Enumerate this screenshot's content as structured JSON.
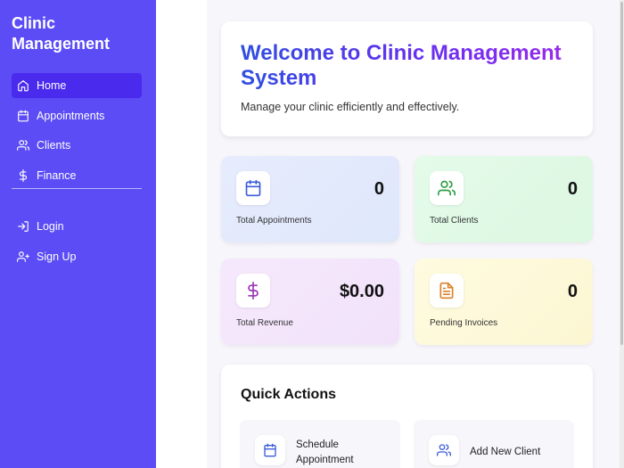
{
  "sidebar": {
    "brand": "Clinic Management",
    "items": [
      {
        "label": "Home",
        "icon": "home-icon",
        "active": true
      },
      {
        "label": "Appointments",
        "icon": "calendar-icon"
      },
      {
        "label": "Clients",
        "icon": "users-icon"
      },
      {
        "label": "Finance",
        "icon": "dollar-icon"
      }
    ],
    "auth_items": [
      {
        "label": "Login",
        "icon": "login-icon"
      },
      {
        "label": "Sign Up",
        "icon": "user-plus-icon"
      }
    ]
  },
  "welcome": {
    "title": "Welcome to Clinic Management System",
    "subtitle": "Manage your clinic efficiently and effectively."
  },
  "stats": [
    {
      "value": "0",
      "label": "Total Appointments",
      "icon": "calendar-icon",
      "color": "#3b5bdb"
    },
    {
      "value": "0",
      "label": "Total Clients",
      "icon": "users-icon",
      "color": "#2f9e44"
    },
    {
      "value": "$0.00",
      "label": "Total Revenue",
      "icon": "dollar-icon",
      "color": "#9c36b5"
    },
    {
      "value": "0",
      "label": "Pending Invoices",
      "icon": "file-text-icon",
      "color": "#d9822b"
    }
  ],
  "quick_actions": {
    "title": "Quick Actions",
    "items": [
      {
        "label": "Schedule Appointment",
        "icon": "calendar-icon"
      },
      {
        "label": "Add New Client",
        "icon": "users-icon"
      }
    ]
  },
  "colors": {
    "sidebar": "#5b4cf5",
    "sidebar_active": "#4a2bee",
    "title_gradient_start": "#2f4fe0",
    "title_gradient_end": "#9d2bea"
  }
}
